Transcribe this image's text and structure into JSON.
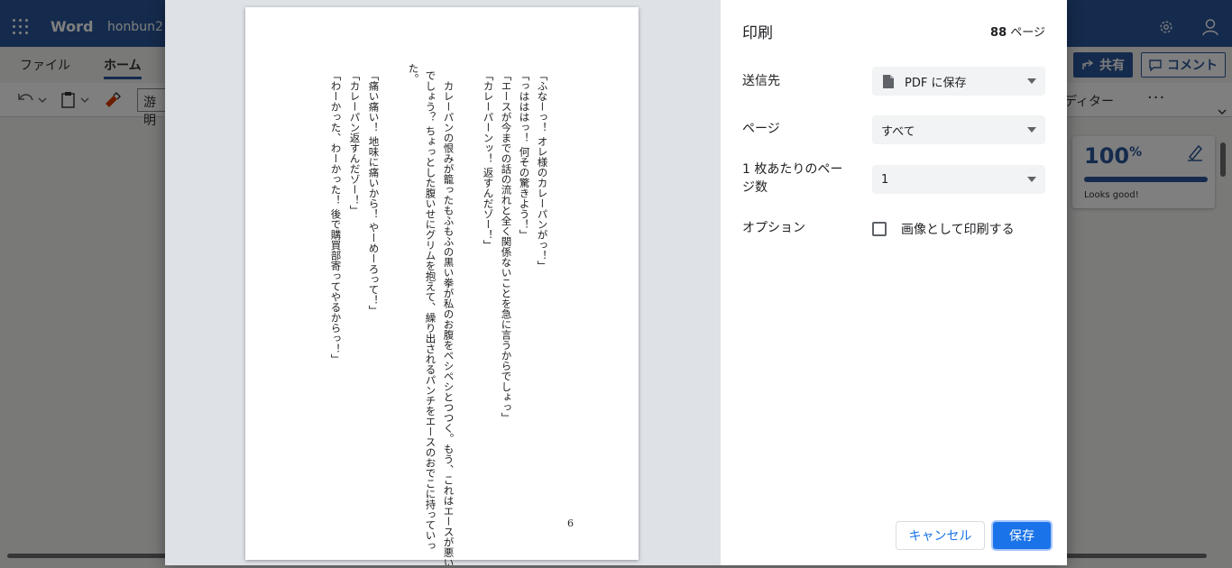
{
  "word": {
    "app_name": "Word",
    "doc_name": "honbun2",
    "tabs": [
      "ファイル",
      "ホーム"
    ],
    "font_name": "游明",
    "share_label": "共有",
    "comment_label": "コメント",
    "editor_label": "ディター",
    "more_label": "···",
    "editor_score": "100",
    "editor_score_unit": "%",
    "editor_status": "Looks good!"
  },
  "preview": {
    "lines": [
      "「ふなーっ！ オレ様のカレーパンがっ！」",
      "「っはははっ！ 何その驚きよう！」",
      "「エースが今までの話の流れと全く関係ないことを急に言うからでしょっ」",
      "「カレーパーンッ！ 返すんだゾー！」",
      "　カレーパンの恨みが籠ったもふもふの黒い拳が私のお腹をペシペシとつつく。もう、これはエースが悪い",
      "でしょう？ ちょっとした腹いせにグリムを抱えて、繰り出されるパンチをエースのおでこに持っていっ",
      "た。",
      "「痛い痛い！ 地味に痛いから！ やーめーろって！」",
      "「カレーパン返すんだゾー！」",
      "「わーかった、わーかった！ 後で購買部寄ってやるからっ！」"
    ],
    "page_number": "6"
  },
  "dialog": {
    "title": "印刷",
    "page_count_number": "88",
    "page_count_unit": " ページ",
    "destination_label": "送信先",
    "destination_value": "PDF に保存",
    "pages_label": "ページ",
    "pages_value": "すべて",
    "per_sheet_label": "1 枚あたりのページ数",
    "per_sheet_value": "1",
    "options_label": "オプション",
    "print_as_image_label": "画像として印刷する",
    "print_as_image_checked": false,
    "cancel_label": "キャンセル",
    "save_label": "保存"
  },
  "colors": {
    "word_blue": "#2b579a",
    "chrome_blue": "#1a73e8"
  }
}
